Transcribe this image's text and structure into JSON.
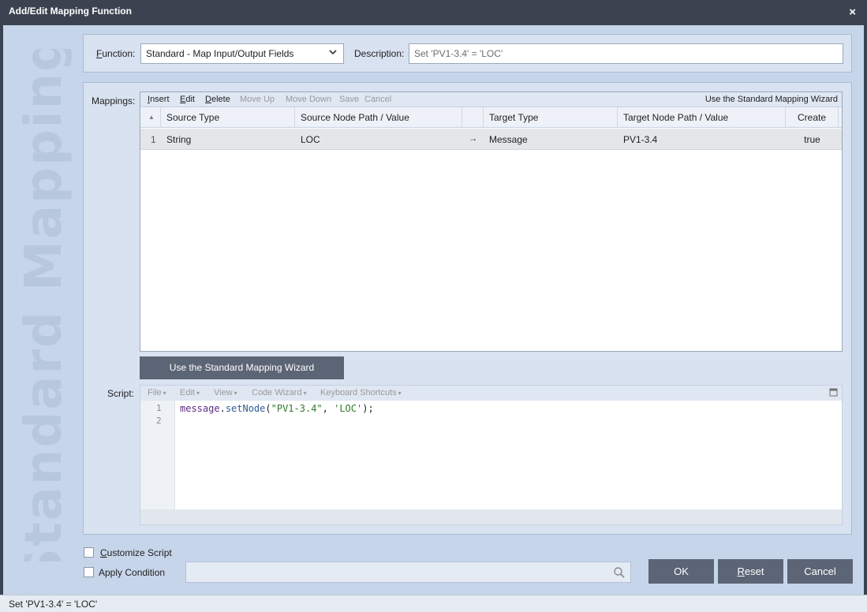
{
  "window": {
    "title": "Add/Edit Mapping Function",
    "close_glyph": "×"
  },
  "watermark": "Standard Mapping",
  "function": {
    "label_accel": "F",
    "label_rest": "unction:",
    "selected": "Standard - Map Input/Output Fields",
    "description_label": "Description:",
    "description_placeholder": "Set 'PV1-3.4' = 'LOC'"
  },
  "mappings": {
    "label": "Mappings:",
    "toolbar": {
      "insert": "Insert",
      "edit": "Edit",
      "delete": "Delete",
      "move_up": "Move Up",
      "move_down": "Move Down",
      "save": "Save",
      "cancel": "Cancel",
      "wizard_link": "Use the Standard Mapping Wizard"
    },
    "columns": [
      "Source Type",
      "Source Node Path / Value",
      "Target Type",
      "Target Node Path / Value",
      "Create"
    ],
    "sort_glyph": "▲",
    "rows": [
      {
        "num": "1",
        "source_type": "String",
        "source_path": "LOC",
        "arrow": "→",
        "target_type": "Message",
        "target_path": "PV1-3.4",
        "create": "true"
      }
    ]
  },
  "wizard_button": "Use the Standard Mapping Wizard",
  "script": {
    "label": "Script:",
    "menu": [
      "File",
      "Edit",
      "View",
      "Code Wizard",
      "Keyboard Shortcuts"
    ],
    "line_numbers": [
      "1",
      "2"
    ],
    "code": {
      "obj": "message",
      "dot": ".",
      "method": "setNode",
      "open": "(",
      "arg1": "\"PV1-3.4\"",
      "sep": ", ",
      "arg2": "'LOC'",
      "close": ");"
    }
  },
  "options": {
    "customize_script": "Customize Script",
    "apply_condition": "Apply Condition"
  },
  "buttons": {
    "ok": "OK",
    "reset": "Reset",
    "cancel": "Cancel"
  },
  "status": "Set 'PV1-3.4' = 'LOC'",
  "colors": {
    "title_bar": "#3b4350",
    "button": "#5c6575",
    "panel": "#d8e2f0",
    "body": "#c7d5ea"
  }
}
